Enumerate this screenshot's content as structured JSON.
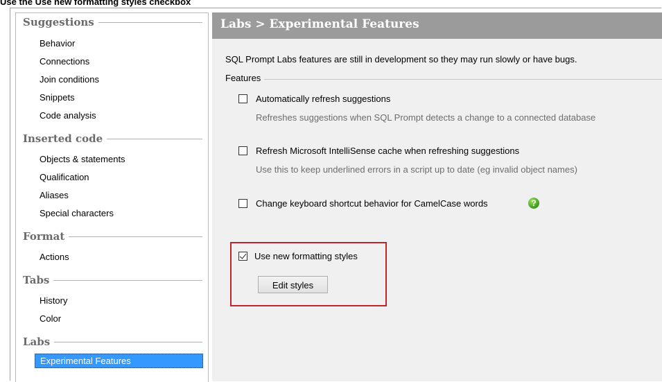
{
  "caption": "Use the Use new formatting styles checkbox",
  "sidebar": {
    "groups": [
      {
        "title": "Suggestions",
        "items": [
          "Behavior",
          "Connections",
          "Join conditions",
          "Snippets",
          "Code analysis"
        ]
      },
      {
        "title": "Inserted code",
        "items": [
          "Objects & statements",
          "Qualification",
          "Aliases",
          "Special characters"
        ]
      },
      {
        "title": "Format",
        "items": [
          "Actions"
        ]
      },
      {
        "title": "Tabs",
        "items": [
          "History",
          "Color"
        ]
      },
      {
        "title": "Labs",
        "items": [
          "Experimental Features"
        ]
      }
    ],
    "selected": "Experimental Features"
  },
  "content": {
    "header": "Labs > Experimental Features",
    "description": "SQL Prompt Labs features are still in development so they may run slowly or have bugs.",
    "features_label": "Features",
    "options": [
      {
        "label": "Automatically refresh suggestions",
        "hint": "Refreshes suggestions when SQL Prompt detects a change to a connected database",
        "checked": false
      },
      {
        "label": "Refresh Microsoft IntelliSense cache when refreshing suggestions",
        "hint": "Use this to keep underlined errors in a script up to date (eg invalid object names)",
        "checked": false
      },
      {
        "label": "Change keyboard shortcut behavior for CamelCase words",
        "hint": "",
        "checked": false,
        "help_icon": "help-icon"
      },
      {
        "label": "Use new formatting styles",
        "hint": "",
        "checked": true
      }
    ],
    "edit_styles_button": "Edit styles",
    "highlight_color": "#c0242c"
  }
}
